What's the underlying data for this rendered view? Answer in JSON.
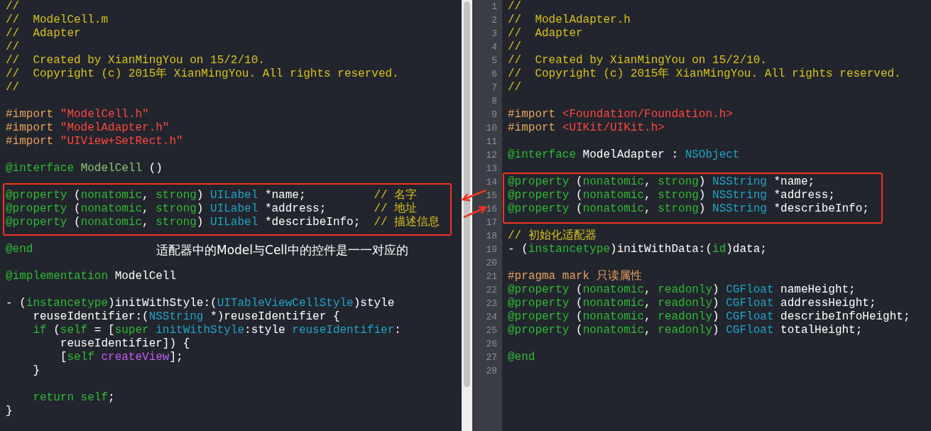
{
  "left_editor": {
    "lines": [
      {
        "kind": "code",
        "tokens": [
          {
            "kind": "comment",
            "text": "//"
          }
        ]
      },
      {
        "kind": "code",
        "tokens": [
          {
            "kind": "comment",
            "text": "//  ModelCell.m"
          }
        ]
      },
      {
        "kind": "code",
        "tokens": [
          {
            "kind": "comment",
            "text": "//  Adapter"
          }
        ]
      },
      {
        "kind": "code",
        "tokens": [
          {
            "kind": "comment",
            "text": "//"
          }
        ]
      },
      {
        "kind": "code",
        "tokens": [
          {
            "kind": "comment",
            "text": "//  Created by XianMingYou on 15/2/10."
          }
        ]
      },
      {
        "kind": "code",
        "tokens": [
          {
            "kind": "comment",
            "text": "//  Copyright (c) 2015年 XianMingYou. All rights reserved."
          }
        ]
      },
      {
        "kind": "code",
        "tokens": [
          {
            "kind": "comment",
            "text": "//"
          }
        ]
      },
      {
        "kind": "blank"
      },
      {
        "kind": "code",
        "tokens": [
          {
            "kind": "preproc",
            "text": "#import "
          },
          {
            "kind": "string",
            "text": "\"ModelCell.h\""
          }
        ]
      },
      {
        "kind": "code",
        "tokens": [
          {
            "kind": "preproc",
            "text": "#import "
          },
          {
            "kind": "string",
            "text": "\"ModelAdapter.h\""
          }
        ]
      },
      {
        "kind": "code",
        "tokens": [
          {
            "kind": "preproc",
            "text": "#import "
          },
          {
            "kind": "string",
            "text": "\"UIView+SetRect.h\""
          }
        ]
      },
      {
        "kind": "blank"
      },
      {
        "kind": "code",
        "tokens": [
          {
            "kind": "keyword",
            "text": "@interface "
          },
          {
            "kind": "project",
            "text": "ModelCell"
          },
          {
            "kind": "plain",
            "text": " ()"
          }
        ]
      },
      {
        "kind": "blank"
      },
      {
        "kind": "code",
        "tokens": [
          {
            "kind": "keyword",
            "text": "@property"
          },
          {
            "kind": "plain",
            "text": " ("
          },
          {
            "kind": "keyword",
            "text": "nonatomic"
          },
          {
            "kind": "plain",
            "text": ", "
          },
          {
            "kind": "keyword",
            "text": "strong"
          },
          {
            "kind": "plain",
            "text": ") "
          },
          {
            "kind": "type",
            "text": "UILabel"
          },
          {
            "kind": "plain",
            "text": " *name;          "
          },
          {
            "kind": "comment",
            "text": "// 名字"
          }
        ]
      },
      {
        "kind": "code",
        "tokens": [
          {
            "kind": "keyword",
            "text": "@property"
          },
          {
            "kind": "plain",
            "text": " ("
          },
          {
            "kind": "keyword",
            "text": "nonatomic"
          },
          {
            "kind": "plain",
            "text": ", "
          },
          {
            "kind": "keyword",
            "text": "strong"
          },
          {
            "kind": "plain",
            "text": ") "
          },
          {
            "kind": "type",
            "text": "UILabel"
          },
          {
            "kind": "plain",
            "text": " *address;       "
          },
          {
            "kind": "comment",
            "text": "// 地址"
          }
        ]
      },
      {
        "kind": "code",
        "tokens": [
          {
            "kind": "keyword",
            "text": "@property"
          },
          {
            "kind": "plain",
            "text": " ("
          },
          {
            "kind": "keyword",
            "text": "nonatomic"
          },
          {
            "kind": "plain",
            "text": ", "
          },
          {
            "kind": "keyword",
            "text": "strong"
          },
          {
            "kind": "plain",
            "text": ") "
          },
          {
            "kind": "type",
            "text": "UILabel"
          },
          {
            "kind": "plain",
            "text": " *describeInfo;  "
          },
          {
            "kind": "comment",
            "text": "// 描述信息"
          }
        ]
      },
      {
        "kind": "blank"
      },
      {
        "kind": "code",
        "tokens": [
          {
            "kind": "keyword",
            "text": "@end"
          }
        ]
      },
      {
        "kind": "blank"
      },
      {
        "kind": "code",
        "tokens": [
          {
            "kind": "keyword",
            "text": "@implementation"
          },
          {
            "kind": "plain",
            "text": " ModelCell"
          }
        ]
      },
      {
        "kind": "blank"
      },
      {
        "kind": "code",
        "tokens": [
          {
            "kind": "plain",
            "text": "- ("
          },
          {
            "kind": "keyword",
            "text": "instancetype"
          },
          {
            "kind": "plain",
            "text": ")initWithStyle:("
          },
          {
            "kind": "type",
            "text": "UITableViewCellStyle"
          },
          {
            "kind": "plain",
            "text": ")style"
          }
        ]
      },
      {
        "kind": "code",
        "tokens": [
          {
            "kind": "plain",
            "text": "    reuseIdentifier:("
          },
          {
            "kind": "type",
            "text": "NSString"
          },
          {
            "kind": "plain",
            "text": " *)reuseIdentifier {"
          }
        ]
      },
      {
        "kind": "code",
        "tokens": [
          {
            "kind": "keyword",
            "text": "    if"
          },
          {
            "kind": "plain",
            "text": " ("
          },
          {
            "kind": "keyword",
            "text": "self"
          },
          {
            "kind": "plain",
            "text": " = ["
          },
          {
            "kind": "keyword",
            "text": "super "
          },
          {
            "kind": "type",
            "text": "initWithStyle"
          },
          {
            "kind": "plain",
            "text": ":style "
          },
          {
            "kind": "type",
            "text": "reuseIdentifier"
          },
          {
            "kind": "plain",
            "text": ":"
          }
        ]
      },
      {
        "kind": "code",
        "tokens": [
          {
            "kind": "plain",
            "text": "        reuseIdentifier]) {"
          }
        ]
      },
      {
        "kind": "code",
        "tokens": [
          {
            "kind": "plain",
            "text": "        ["
          },
          {
            "kind": "keyword",
            "text": "self "
          },
          {
            "kind": "method",
            "text": "createView"
          },
          {
            "kind": "plain",
            "text": "];"
          }
        ]
      },
      {
        "kind": "code",
        "tokens": [
          {
            "kind": "plain",
            "text": "    }"
          }
        ]
      },
      {
        "kind": "blank"
      },
      {
        "kind": "code",
        "tokens": [
          {
            "kind": "keyword",
            "text": "    return self"
          },
          {
            "kind": "plain",
            "text": ";"
          }
        ]
      },
      {
        "kind": "code",
        "tokens": [
          {
            "kind": "plain",
            "text": "}"
          }
        ]
      }
    ]
  },
  "annotation": {
    "text": "适配器中的Model与Cell中的控件是一一对应的"
  },
  "right_editor": {
    "lines": [
      {
        "number": "1",
        "tokens": [
          {
            "kind": "comment",
            "text": "//"
          }
        ]
      },
      {
        "number": "2",
        "tokens": [
          {
            "kind": "comment",
            "text": "//  ModelAdapter.h"
          }
        ]
      },
      {
        "number": "3",
        "tokens": [
          {
            "kind": "comment",
            "text": "//  Adapter"
          }
        ]
      },
      {
        "number": "4",
        "tokens": [
          {
            "kind": "comment",
            "text": "//"
          }
        ]
      },
      {
        "number": "5",
        "tokens": [
          {
            "kind": "comment",
            "text": "//  Created by XianMingYou on 15/2/10."
          }
        ]
      },
      {
        "number": "6",
        "tokens": [
          {
            "kind": "comment",
            "text": "//  Copyright (c) 2015年 XianMingYou. All rights reserved."
          }
        ]
      },
      {
        "number": "7",
        "tokens": [
          {
            "kind": "comment",
            "text": "//"
          }
        ]
      },
      {
        "number": "8"
      },
      {
        "number": "9",
        "tokens": [
          {
            "kind": "preproc",
            "text": "#import "
          },
          {
            "kind": "string",
            "text": "<Foundation/Foundation.h>"
          }
        ]
      },
      {
        "number": "10",
        "tokens": [
          {
            "kind": "preproc",
            "text": "#import "
          },
          {
            "kind": "string",
            "text": "<UIKit/UIKit.h>"
          }
        ]
      },
      {
        "number": "11"
      },
      {
        "number": "12",
        "tokens": [
          {
            "kind": "keyword",
            "text": "@interface"
          },
          {
            "kind": "plain",
            "text": " ModelAdapter : "
          },
          {
            "kind": "type",
            "text": "NSObject"
          }
        ]
      },
      {
        "number": "13"
      },
      {
        "number": "14",
        "tokens": [
          {
            "kind": "keyword",
            "text": "@property"
          },
          {
            "kind": "plain",
            "text": " ("
          },
          {
            "kind": "keyword",
            "text": "nonatomic"
          },
          {
            "kind": "plain",
            "text": ", "
          },
          {
            "kind": "keyword",
            "text": "strong"
          },
          {
            "kind": "plain",
            "text": ") "
          },
          {
            "kind": "type",
            "text": "NSString"
          },
          {
            "kind": "plain",
            "text": " *name;"
          }
        ]
      },
      {
        "number": "15",
        "tokens": [
          {
            "kind": "keyword",
            "text": "@property"
          },
          {
            "kind": "plain",
            "text": " ("
          },
          {
            "kind": "keyword",
            "text": "nonatomic"
          },
          {
            "kind": "plain",
            "text": ", "
          },
          {
            "kind": "keyword",
            "text": "strong"
          },
          {
            "kind": "plain",
            "text": ") "
          },
          {
            "kind": "type",
            "text": "NSString"
          },
          {
            "kind": "plain",
            "text": " *address;"
          }
        ]
      },
      {
        "number": "16",
        "tokens": [
          {
            "kind": "keyword",
            "text": "@property"
          },
          {
            "kind": "plain",
            "text": " ("
          },
          {
            "kind": "keyword",
            "text": "nonatomic"
          },
          {
            "kind": "plain",
            "text": ", "
          },
          {
            "kind": "keyword",
            "text": "strong"
          },
          {
            "kind": "plain",
            "text": ") "
          },
          {
            "kind": "type",
            "text": "NSString"
          },
          {
            "kind": "plain",
            "text": " *describeInfo;"
          }
        ]
      },
      {
        "number": "17"
      },
      {
        "number": "18",
        "tokens": [
          {
            "kind": "comment",
            "text": "// 初始化适配器"
          }
        ]
      },
      {
        "number": "19",
        "tokens": [
          {
            "kind": "plain",
            "text": "- ("
          },
          {
            "kind": "keyword",
            "text": "instancetype"
          },
          {
            "kind": "plain",
            "text": ")initWithData:("
          },
          {
            "kind": "keyword",
            "text": "id"
          },
          {
            "kind": "plain",
            "text": ")data;"
          }
        ]
      },
      {
        "number": "20"
      },
      {
        "number": "21",
        "tokens": [
          {
            "kind": "preproc",
            "text": "#pragma mark 只读属性"
          }
        ]
      },
      {
        "number": "22",
        "tokens": [
          {
            "kind": "keyword",
            "text": "@property"
          },
          {
            "kind": "plain",
            "text": " ("
          },
          {
            "kind": "keyword",
            "text": "nonatomic"
          },
          {
            "kind": "plain",
            "text": ", "
          },
          {
            "kind": "keyword",
            "text": "readonly"
          },
          {
            "kind": "plain",
            "text": ") "
          },
          {
            "kind": "type",
            "text": "CGFloat"
          },
          {
            "kind": "plain",
            "text": " nameHeight;"
          }
        ]
      },
      {
        "number": "23",
        "tokens": [
          {
            "kind": "keyword",
            "text": "@property"
          },
          {
            "kind": "plain",
            "text": " ("
          },
          {
            "kind": "keyword",
            "text": "nonatomic"
          },
          {
            "kind": "plain",
            "text": ", "
          },
          {
            "kind": "keyword",
            "text": "readonly"
          },
          {
            "kind": "plain",
            "text": ") "
          },
          {
            "kind": "type",
            "text": "CGFloat"
          },
          {
            "kind": "plain",
            "text": " addressHeight;"
          }
        ]
      },
      {
        "number": "24",
        "tokens": [
          {
            "kind": "keyword",
            "text": "@property"
          },
          {
            "kind": "plain",
            "text": " ("
          },
          {
            "kind": "keyword",
            "text": "nonatomic"
          },
          {
            "kind": "plain",
            "text": ", "
          },
          {
            "kind": "keyword",
            "text": "readonly"
          },
          {
            "kind": "plain",
            "text": ") "
          },
          {
            "kind": "type",
            "text": "CGFloat"
          },
          {
            "kind": "plain",
            "text": " describeInfoHeight;"
          }
        ]
      },
      {
        "number": "25",
        "tokens": [
          {
            "kind": "keyword",
            "text": "@property"
          },
          {
            "kind": "plain",
            "text": " ("
          },
          {
            "kind": "keyword",
            "text": "nonatomic"
          },
          {
            "kind": "plain",
            "text": ", "
          },
          {
            "kind": "keyword",
            "text": "readonly"
          },
          {
            "kind": "plain",
            "text": ") "
          },
          {
            "kind": "type",
            "text": "CGFloat"
          },
          {
            "kind": "plain",
            "text": " totalHeight;"
          }
        ]
      },
      {
        "number": "26"
      },
      {
        "number": "27",
        "tokens": [
          {
            "kind": "keyword",
            "text": "@end"
          }
        ]
      },
      {
        "number": "28"
      }
    ]
  }
}
